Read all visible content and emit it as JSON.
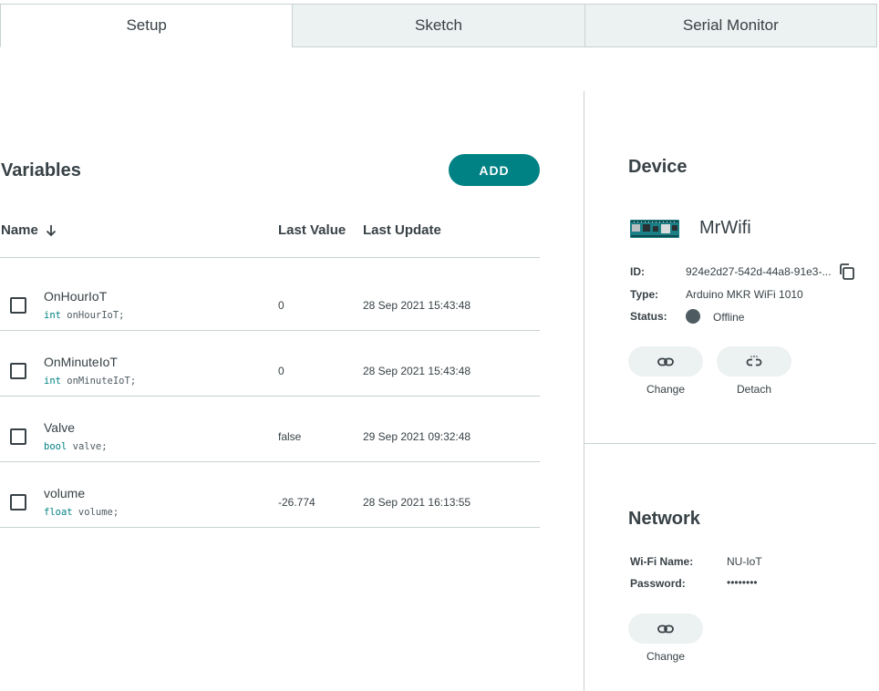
{
  "tabs": [
    {
      "label": "Setup",
      "active": true
    },
    {
      "label": "Sketch",
      "active": false
    },
    {
      "label": "Serial Monitor",
      "active": false
    }
  ],
  "variables": {
    "title": "Variables",
    "add_label": "ADD",
    "columns": {
      "name": "Name",
      "last_value": "Last Value",
      "last_update": "Last Update"
    },
    "rows": [
      {
        "name": "OnHourIoT",
        "type": "int",
        "decl": " onHourIoT;",
        "value": "0",
        "updated": "28 Sep 2021 15:43:48"
      },
      {
        "name": "OnMinuteIoT",
        "type": "int",
        "decl": " onMinuteIoT;",
        "value": "0",
        "updated": "28 Sep 2021 15:43:48"
      },
      {
        "name": "Valve",
        "type": "bool",
        "decl": " valve;",
        "value": "false",
        "updated": "29 Sep 2021 09:32:48"
      },
      {
        "name": "volume",
        "type": "float",
        "decl": " volume;",
        "value": "-26.774",
        "updated": "28 Sep 2021 16:13:55"
      }
    ]
  },
  "device": {
    "title": "Device",
    "name": "MrWifi",
    "id_label": "ID:",
    "id_value": "924e2d27-542d-44a8-91e3-...",
    "type_label": "Type:",
    "type_value": "Arduino MKR WiFi 1010",
    "status_label": "Status:",
    "status_value": "Offline",
    "change_label": "Change",
    "detach_label": "Detach"
  },
  "network": {
    "title": "Network",
    "wifi_label": "Wi-Fi Name:",
    "wifi_value": "NU-IoT",
    "password_label": "Password:",
    "password_value": "••••••••",
    "change_label": "Change"
  },
  "colors": {
    "accent": "#008184",
    "text": "#374146",
    "pill_bg": "#ecf1f1",
    "status_offline": "#4e5b61"
  }
}
